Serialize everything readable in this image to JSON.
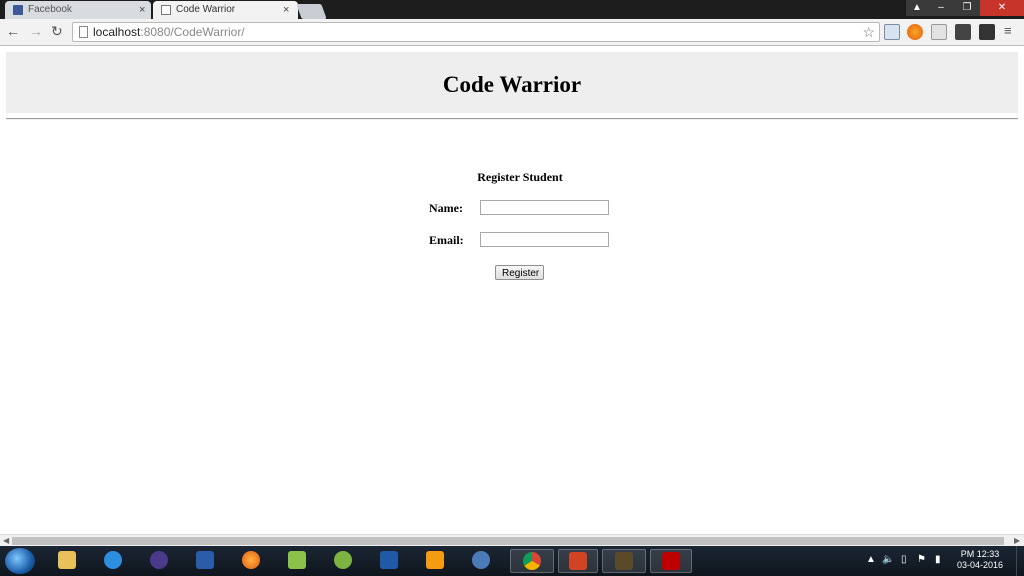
{
  "browser": {
    "tabs": [
      {
        "label": "Facebook",
        "active": false
      },
      {
        "label": "Code Warrior",
        "active": true
      }
    ],
    "tab_close_glyph": "×",
    "url_host": "localhost",
    "url_path": ":8080/CodeWarrior/",
    "window_buttons": {
      "minimize": "–",
      "maximize": "❐",
      "close": "✕"
    }
  },
  "page": {
    "title": "Code Warrior",
    "form": {
      "heading": "Register Student",
      "fields": [
        {
          "label": "Name:",
          "value": ""
        },
        {
          "label": "Email:",
          "value": ""
        }
      ],
      "submit_label": "Register"
    }
  },
  "taskbar": {
    "clock_ampm": "PM 12:33",
    "date": "03-04-2016"
  },
  "colors": {
    "header_band": "#eeeeee",
    "taskbar": "#15202c",
    "close_button": "#c7342a"
  }
}
